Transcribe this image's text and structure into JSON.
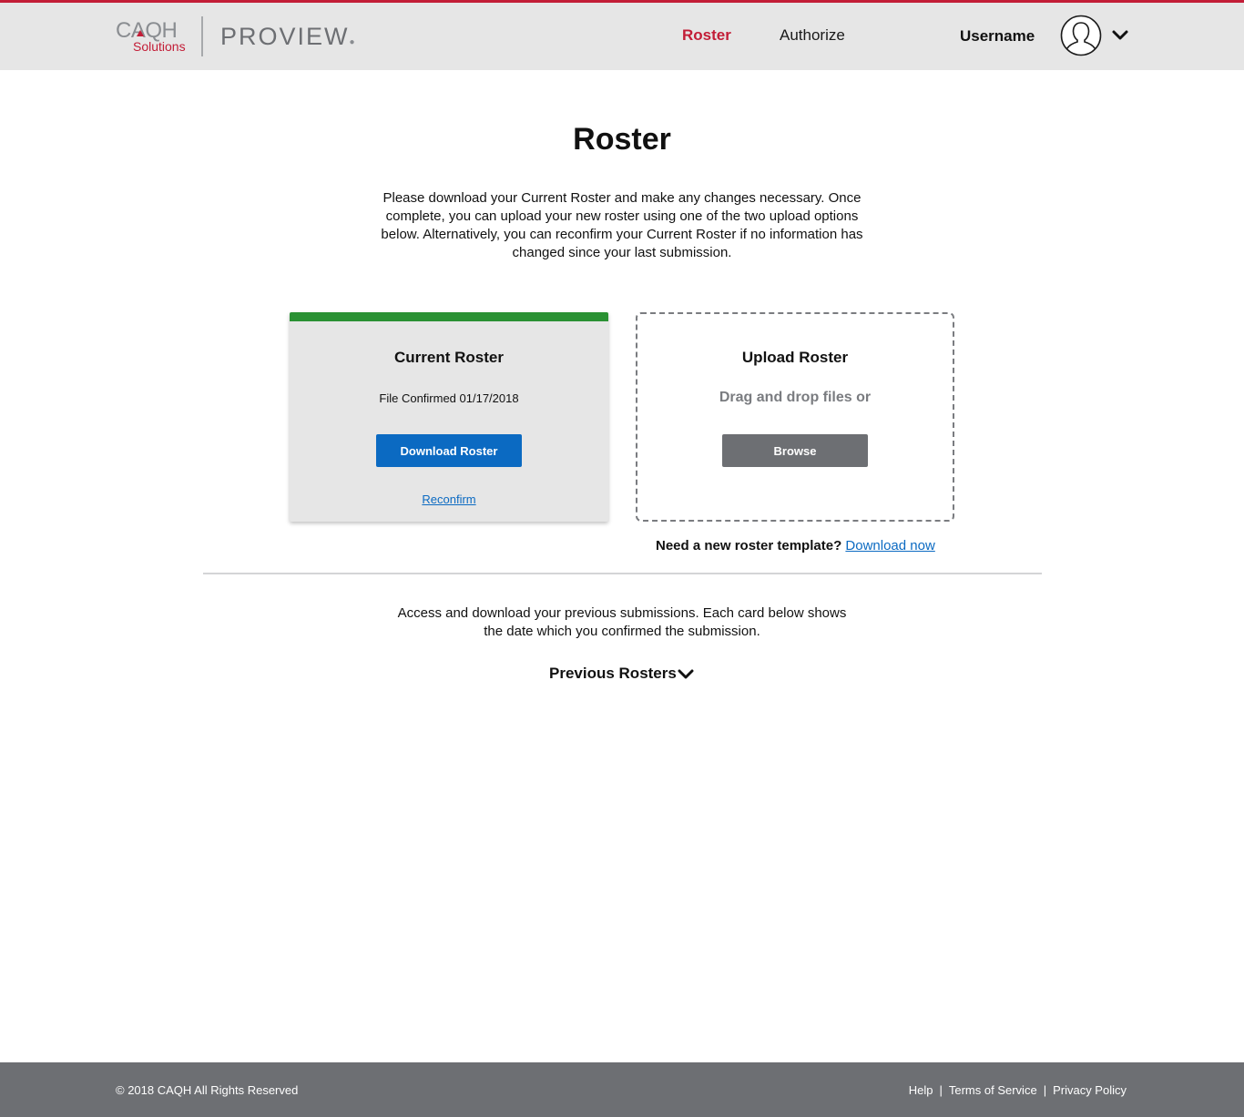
{
  "brand": {
    "caqh": "CAQH",
    "solutions": "Solutions",
    "product": "PROVIEW"
  },
  "nav": {
    "roster": "Roster",
    "authorize": "Authorize",
    "username": "Username"
  },
  "main": {
    "title": "Roster",
    "intro": "Please download your Current Roster and make any changes necessary. Once complete, you can upload your new roster using one of the two upload options below. Alternatively, you can reconfirm your Current Roster if no information has changed since your last submission.",
    "current": {
      "title": "Current Roster",
      "status": "File Confirmed 01/17/2018",
      "download_label": "Download Roster",
      "reconfirm_label": "Reconfirm"
    },
    "upload": {
      "title": "Upload Roster",
      "drag_text": "Drag and drop files or",
      "browse_label": "Browse"
    },
    "template": {
      "question": "Need a new roster template?",
      "link": "Download now"
    },
    "previous": {
      "text": "Access and download your previous submissions. Each card below shows the date which you confirmed the submission.",
      "toggle": "Previous Rosters"
    }
  },
  "footer": {
    "copyright": "© 2018 CAQH All Rights Reserved",
    "links": [
      "Help",
      "Terms of Service",
      "Privacy Policy"
    ]
  },
  "colors": {
    "accent": "#c31d37",
    "primary_button": "#0b6ac2",
    "success_bar": "#2a9133",
    "footer_bg": "#6d6f73"
  },
  "icons": {
    "user": "user-avatar-icon",
    "dropdown": "chevron-down-icon"
  }
}
